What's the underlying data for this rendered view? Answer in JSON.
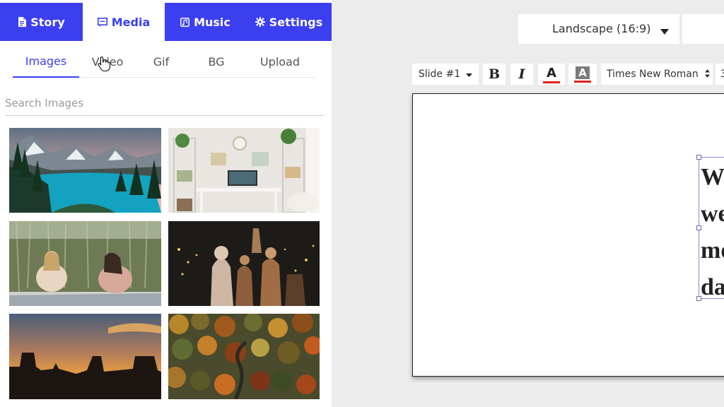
{
  "main_tabs": [
    {
      "label": "Story",
      "icon": "document-icon"
    },
    {
      "label": "Media",
      "icon": "image-icon",
      "active": true
    },
    {
      "label": "Music",
      "icon": "music-icon"
    },
    {
      "label": "Settings",
      "icon": "gear-icon"
    }
  ],
  "sub_tabs": [
    {
      "label": "Images",
      "active": true
    },
    {
      "label": "Video"
    },
    {
      "label": "Gif"
    },
    {
      "label": "BG"
    },
    {
      "label": "Upload"
    }
  ],
  "search": {
    "placeholder": "Search Images",
    "value": ""
  },
  "thumbnails": [
    {
      "subject": "mountain lake"
    },
    {
      "subject": "desk setup"
    },
    {
      "subject": "two women in reeds"
    },
    {
      "subject": "nativity figures"
    },
    {
      "subject": "desert sunset"
    },
    {
      "subject": "autumn forest road"
    }
  ],
  "orientation": {
    "selected": "Landscape (16:9)"
  },
  "toolbar": {
    "slide": "Slide #1",
    "bold": "B",
    "italic": "I",
    "text_color": "A",
    "bg_color": "A",
    "font": "Times New Roman",
    "size": "3"
  },
  "text_lines": [
    "W",
    "we",
    "mo",
    "da"
  ],
  "colors": {
    "accent": "#3c3ff0",
    "text_color_bar": "#e02020"
  }
}
